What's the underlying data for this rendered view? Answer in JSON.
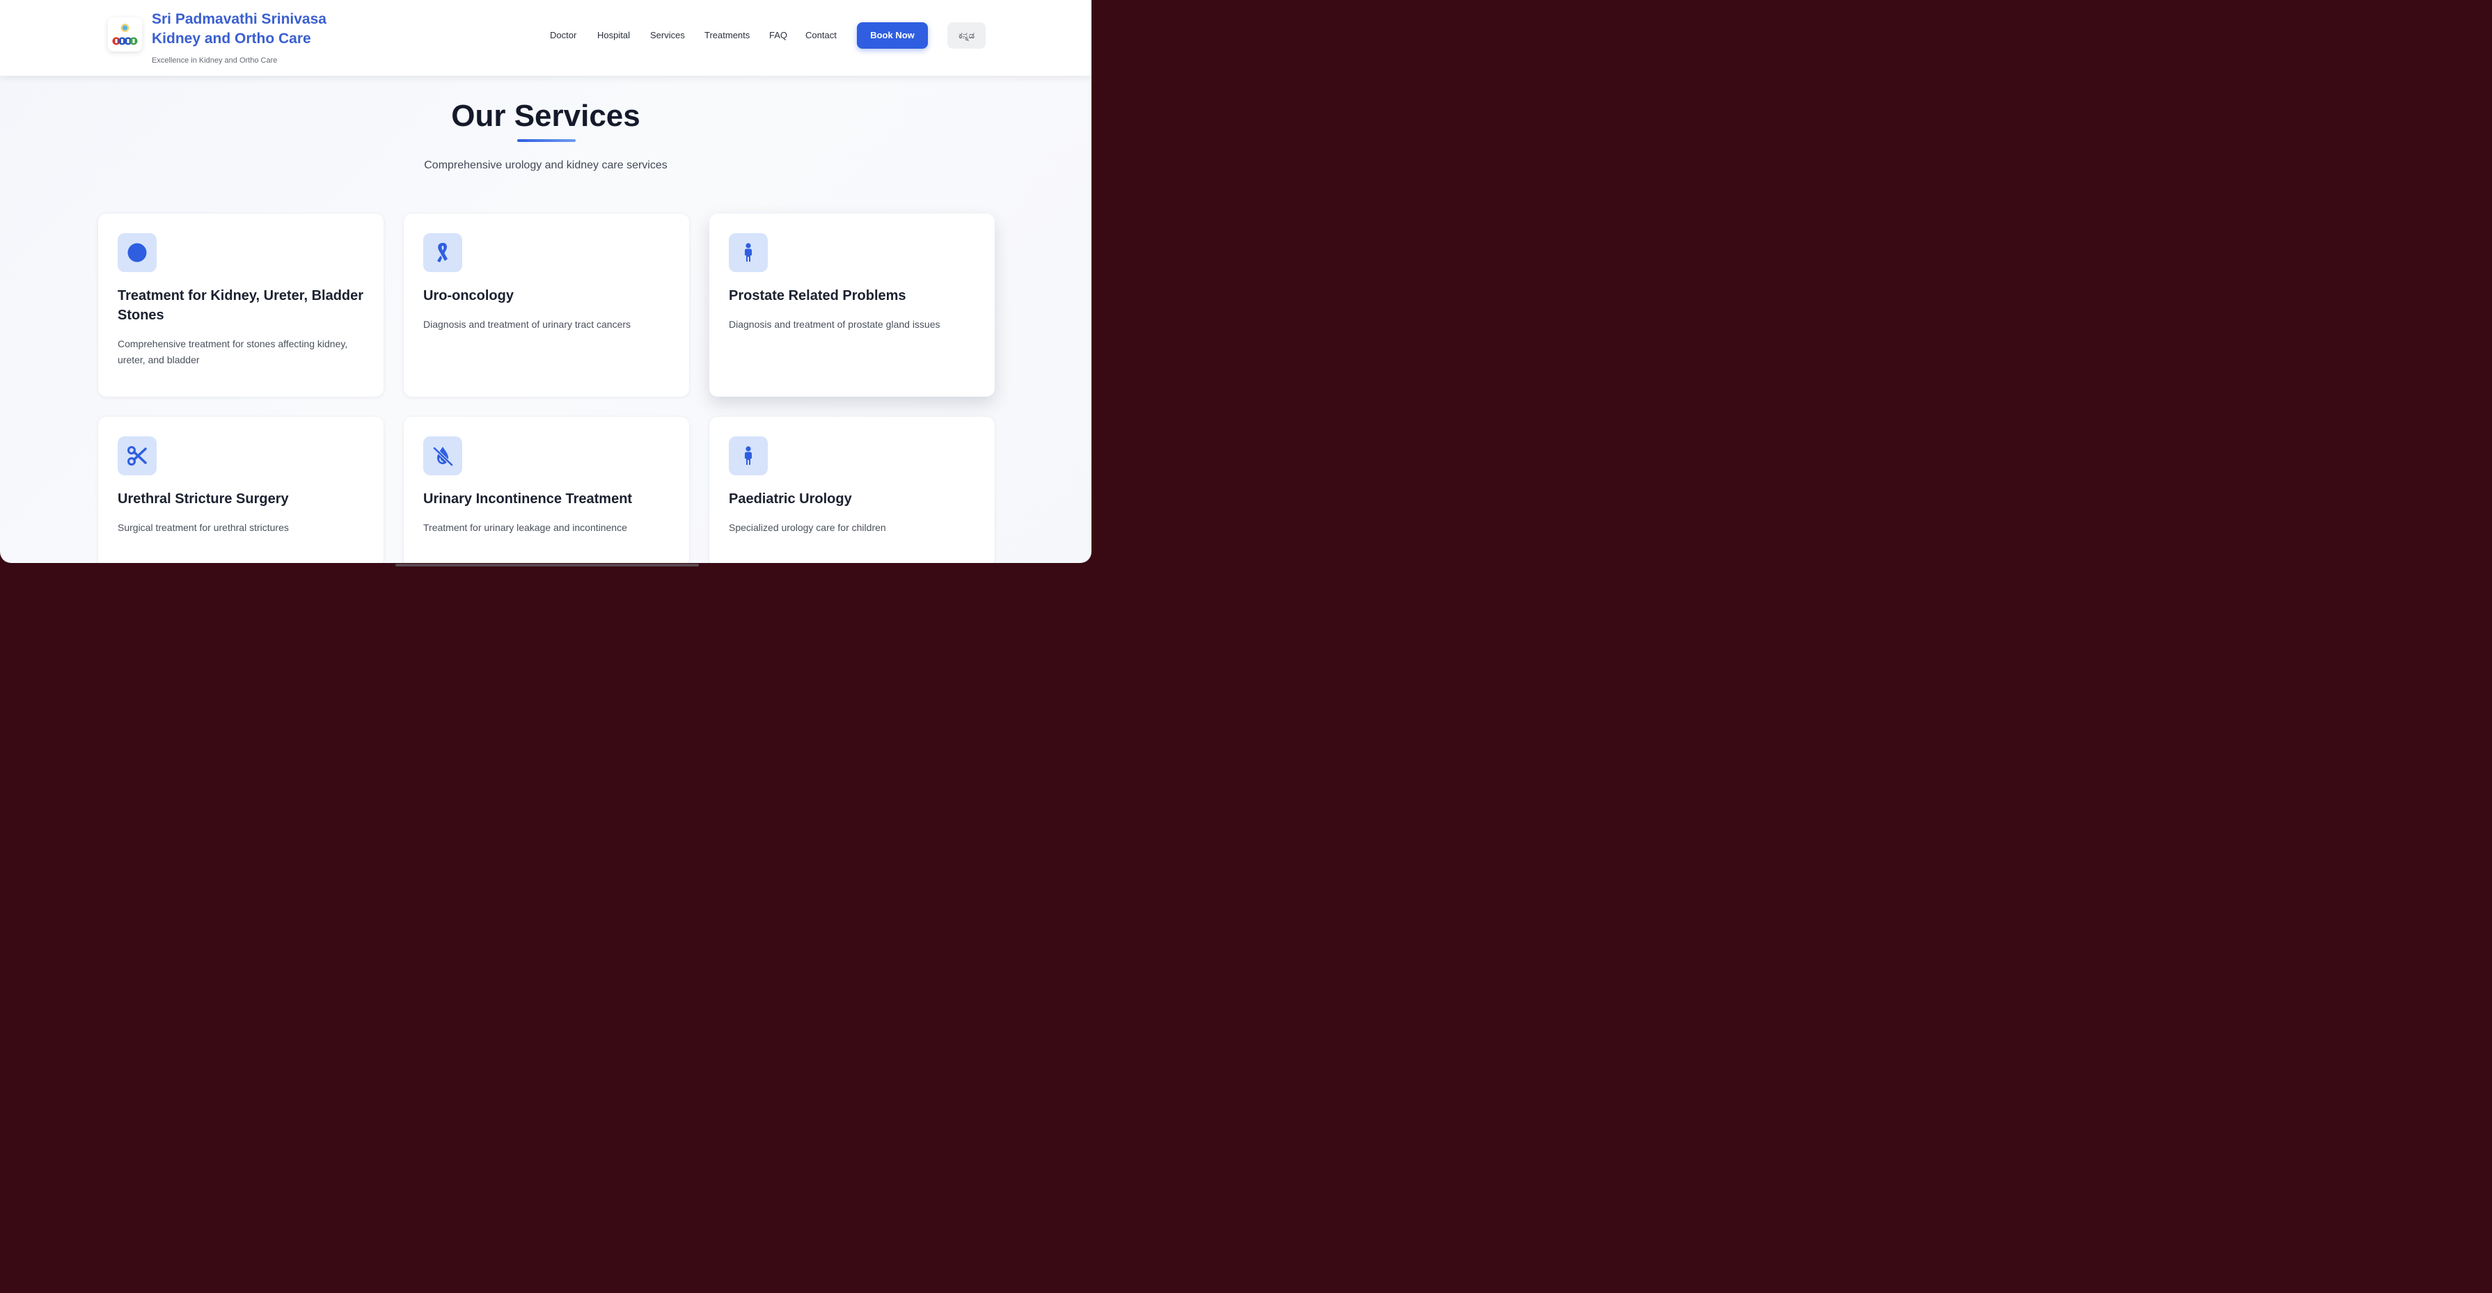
{
  "header": {
    "brand_title": "Sri Padmavathi Srinivasa Kidney and Ortho Care",
    "brand_tagline": "Excellence in Kidney and Ortho Care",
    "logo_icon": "hospital-logo-icon",
    "nav": [
      {
        "label": "Doctor"
      },
      {
        "label": "Hospital"
      },
      {
        "label": "Services"
      },
      {
        "label": "Treatments"
      },
      {
        "label": "FAQ"
      },
      {
        "label": "Contact"
      }
    ],
    "book_label": "Book Now",
    "lang_label": "ಕನ್ನಡ",
    "accent_color": "#2f5ee0"
  },
  "services": {
    "title": "Our Services",
    "subtitle": "Comprehensive urology and kidney care services",
    "cards": [
      {
        "icon": "circle-icon",
        "title": "Treatment for Kidney, Ureter, Bladder Stones",
        "description": "Comprehensive treatment for stones affecting kidney, ureter, and bladder"
      },
      {
        "icon": "ribbon-icon",
        "title": "Uro-oncology",
        "description": "Diagnosis and treatment of urinary tract cancers"
      },
      {
        "icon": "person-icon",
        "title": "Prostate Related Problems",
        "description": "Diagnosis and treatment of prostate gland issues"
      },
      {
        "icon": "scissors-icon",
        "title": "Urethral Stricture Surgery",
        "description": "Surgical treatment for urethral strictures"
      },
      {
        "icon": "droplet-slash-icon",
        "title": "Urinary Incontinence Treatment",
        "description": "Treatment for urinary leakage and incontinence"
      },
      {
        "icon": "child-icon",
        "title": "Paediatric Urology",
        "description": "Specialized urology care for children"
      }
    ]
  }
}
